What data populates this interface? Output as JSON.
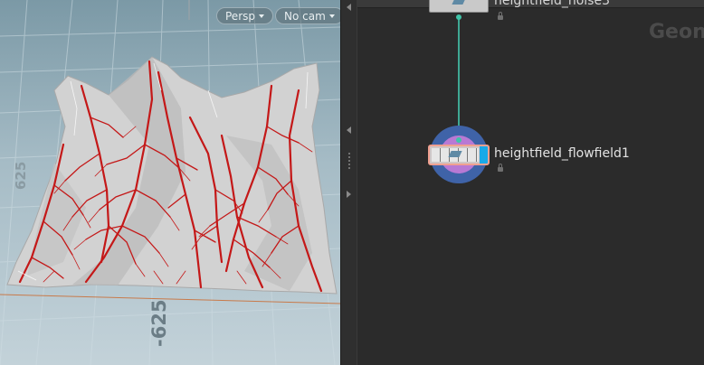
{
  "viewport": {
    "camera_mode_label": "Persp",
    "camera_label": "No cam",
    "axis_label_bottom": "-625",
    "axis_label_left": "625"
  },
  "network": {
    "context_label": "Geon",
    "nodes": [
      {
        "label": "heightfield_noise3"
      },
      {
        "label": "heightfield_flowfield1"
      }
    ]
  },
  "colors": {
    "flow_lines": "#c41818",
    "terrain": "#d5d5d5",
    "wire": "#3fa894",
    "display_flag": "#19a9e8",
    "selection_outline": "#f0a090"
  }
}
